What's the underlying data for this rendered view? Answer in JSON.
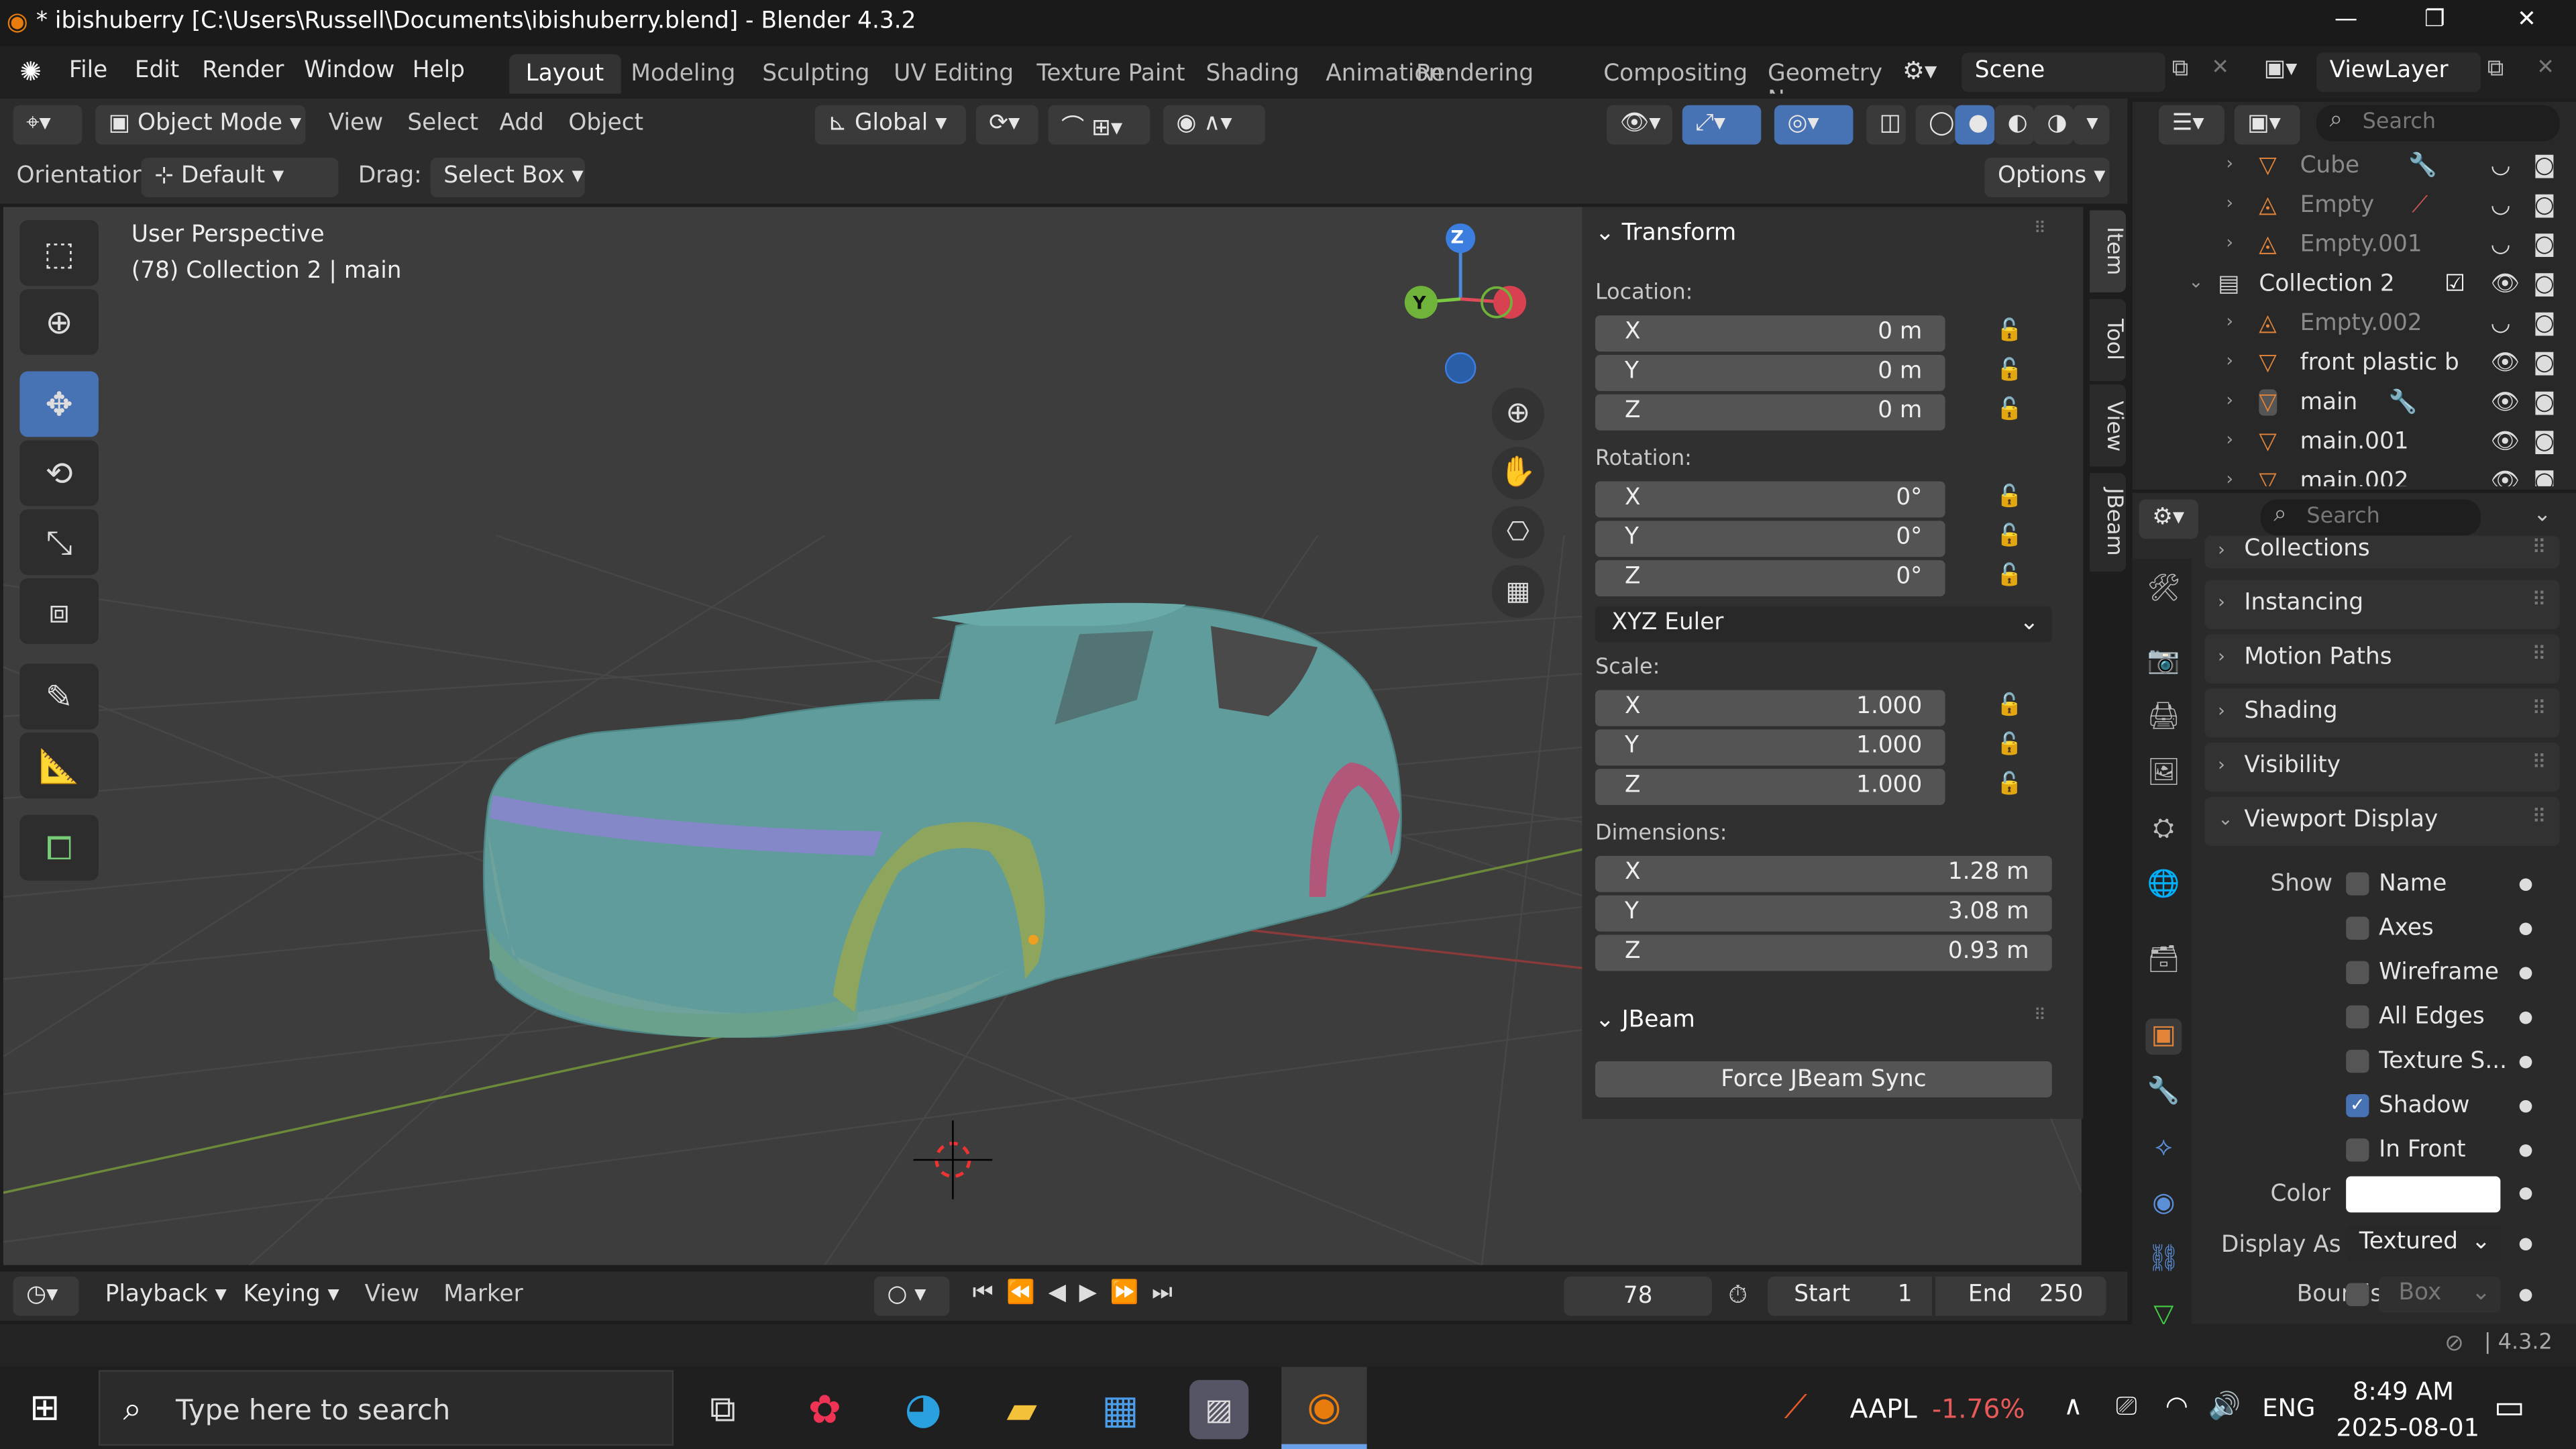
{
  "window": {
    "title": "* ibishuberry [C:\\Users\\Russell\\Documents\\ibishuberry.blend] - Blender 4.3.2",
    "min": "—",
    "max": "❐",
    "close": "✕"
  },
  "menu": [
    "File",
    "Edit",
    "Render",
    "Window",
    "Help"
  ],
  "workspaces": [
    "Layout",
    "Modeling",
    "Sculpting",
    "UV Editing",
    "Texture Paint",
    "Shading",
    "Animation",
    "Rendering",
    "Compositing",
    "Geometry N"
  ],
  "scene": "Scene",
  "view_layer": "ViewLayer",
  "viewport_header": {
    "mode": "Object Mode",
    "menus": [
      "View",
      "Select",
      "Add",
      "Object"
    ],
    "transform_orientation": "Global",
    "orientation_label": "Orientation:",
    "orientation_value": "Default",
    "drag_label": "Drag:",
    "drag_value": "Select Box",
    "options": "Options"
  },
  "viewport": {
    "view_name": "User Perspective",
    "collection_info": "(78) Collection 2 | main",
    "gizmo": {
      "z": "Z",
      "y": "Y"
    }
  },
  "npanel": {
    "tabs": [
      "Item",
      "Tool",
      "View",
      "JBeam"
    ],
    "transform_title": "Transform",
    "location_label": "Location:",
    "location": {
      "x": "0 m",
      "y": "0 m",
      "z": "0 m"
    },
    "rotation_label": "Rotation:",
    "rotation": {
      "x": "0°",
      "y": "0°",
      "z": "0°"
    },
    "rotation_mode": "XYZ Euler",
    "scale_label": "Scale:",
    "scale": {
      "x": "1.000",
      "y": "1.000",
      "z": "1.000"
    },
    "dimensions_label": "Dimensions:",
    "dimensions": {
      "x": "1.28 m",
      "y": "3.08 m",
      "z": "0.93 m"
    },
    "axis": {
      "x": "X",
      "y": "Y",
      "z": "Z"
    },
    "jbeam_title": "JBeam",
    "jbeam_button": "Force JBeam Sync"
  },
  "outliner": {
    "search_placeholder": "Search",
    "items": [
      {
        "name": "Cube"
      },
      {
        "name": "Empty"
      },
      {
        "name": "Empty.001"
      },
      {
        "name": "Collection 2"
      },
      {
        "name": "Empty.002"
      },
      {
        "name": "front plastic b"
      },
      {
        "name": "main"
      },
      {
        "name": "main.001"
      },
      {
        "name": "main.002"
      }
    ]
  },
  "properties": {
    "search_placeholder": "Search",
    "sections": [
      "Collections",
      "Instancing",
      "Motion Paths",
      "Shading",
      "Visibility",
      "Viewport Display"
    ],
    "show_label": "Show",
    "checkboxes": [
      {
        "label": "Name",
        "checked": false
      },
      {
        "label": "Axes",
        "checked": false
      },
      {
        "label": "Wireframe",
        "checked": false
      },
      {
        "label": "All Edges",
        "checked": false
      },
      {
        "label": "Texture S...",
        "checked": false
      },
      {
        "label": "Shadow",
        "checked": true
      },
      {
        "label": "In Front",
        "checked": false
      }
    ],
    "color_label": "Color",
    "display_as_label": "Display As",
    "display_as_value": "Textured",
    "bounds_label": "Bounds",
    "bounds_value": "Box"
  },
  "timeline": {
    "menus": [
      "Playback",
      "Keying",
      "View",
      "Marker"
    ],
    "current_frame": "78",
    "start_label": "Start",
    "start": "1",
    "end_label": "End",
    "end": "250"
  },
  "statusbar": {
    "version": "4.3.2"
  },
  "taskbar": {
    "search_placeholder": "Type here to search",
    "stock_symbol": "AAPL",
    "stock_change": "-1.76%",
    "lang": "ENG",
    "time": "8:49 AM",
    "date": "2025-08-01"
  }
}
